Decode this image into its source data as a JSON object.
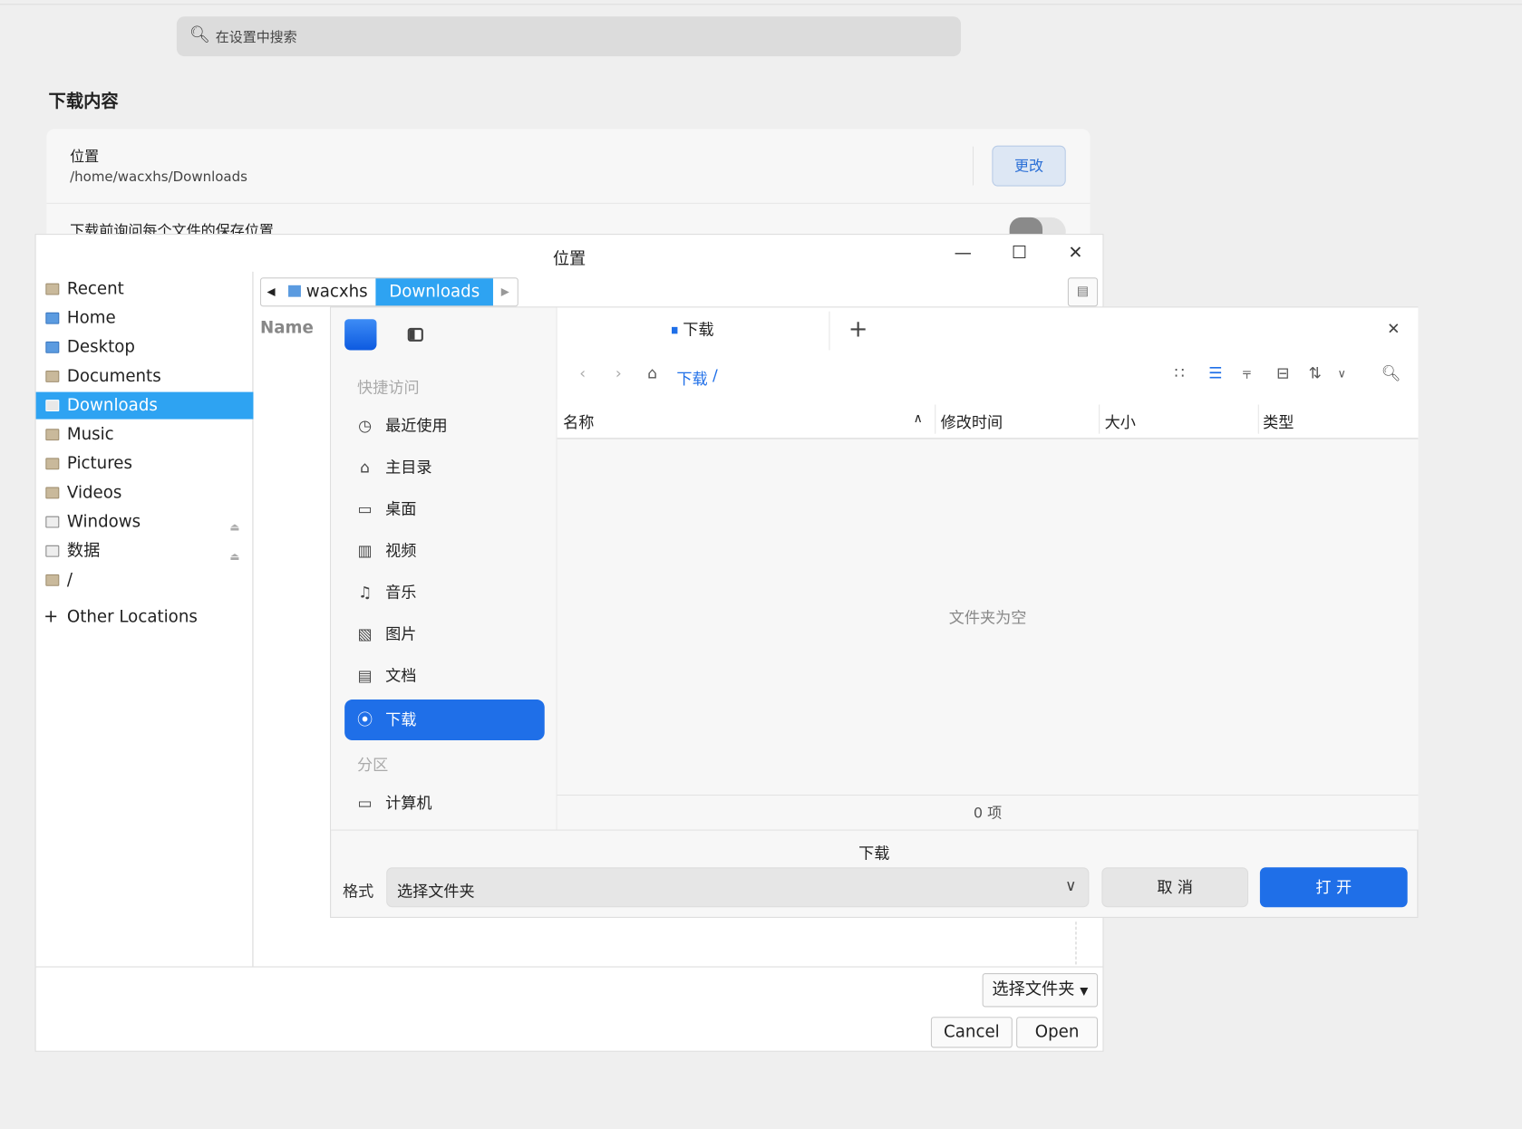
{
  "settings": {
    "search_placeholder": "在设置中搜索",
    "section_title": "下载内容",
    "location_label": "位置",
    "location_path": "/home/wacxhs/Downloads",
    "change_button": "更改",
    "ask_label": "下载前询问每个文件的保存位置"
  },
  "gtk_dialog": {
    "title": "位置",
    "sidebar": [
      {
        "label": "Recent"
      },
      {
        "label": "Home"
      },
      {
        "label": "Desktop"
      },
      {
        "label": "Documents"
      },
      {
        "label": "Downloads",
        "selected": true
      },
      {
        "label": "Music"
      },
      {
        "label": "Pictures"
      },
      {
        "label": "Videos"
      },
      {
        "label": "Windows"
      },
      {
        "label": "数据"
      },
      {
        "label": "/"
      }
    ],
    "other_locations": "Other Locations",
    "path": [
      "wacxhs",
      "Downloads"
    ],
    "name_header": "Name",
    "filter": "选择文件夹",
    "cancel": "Cancel",
    "open": "Open"
  },
  "dde_dialog": {
    "tab": "下载",
    "breadcrumb": "下载",
    "breadcrumb_sep": "/",
    "quick_access": "快捷访问",
    "items": [
      "最近使用",
      "主目录",
      "桌面",
      "视频",
      "音乐",
      "图片",
      "文档",
      "下载"
    ],
    "partition": "分区",
    "computer": "计算机",
    "columns": {
      "name": "名称",
      "modified": "修改时间",
      "size": "大小",
      "type": "类型"
    },
    "empty": "文件夹为空",
    "count": "0 项",
    "current": "下载",
    "format_label": "格式",
    "format_value": "选择文件夹",
    "cancel": "取 消",
    "open": "打 开",
    "accent": "#1f6fe8"
  }
}
